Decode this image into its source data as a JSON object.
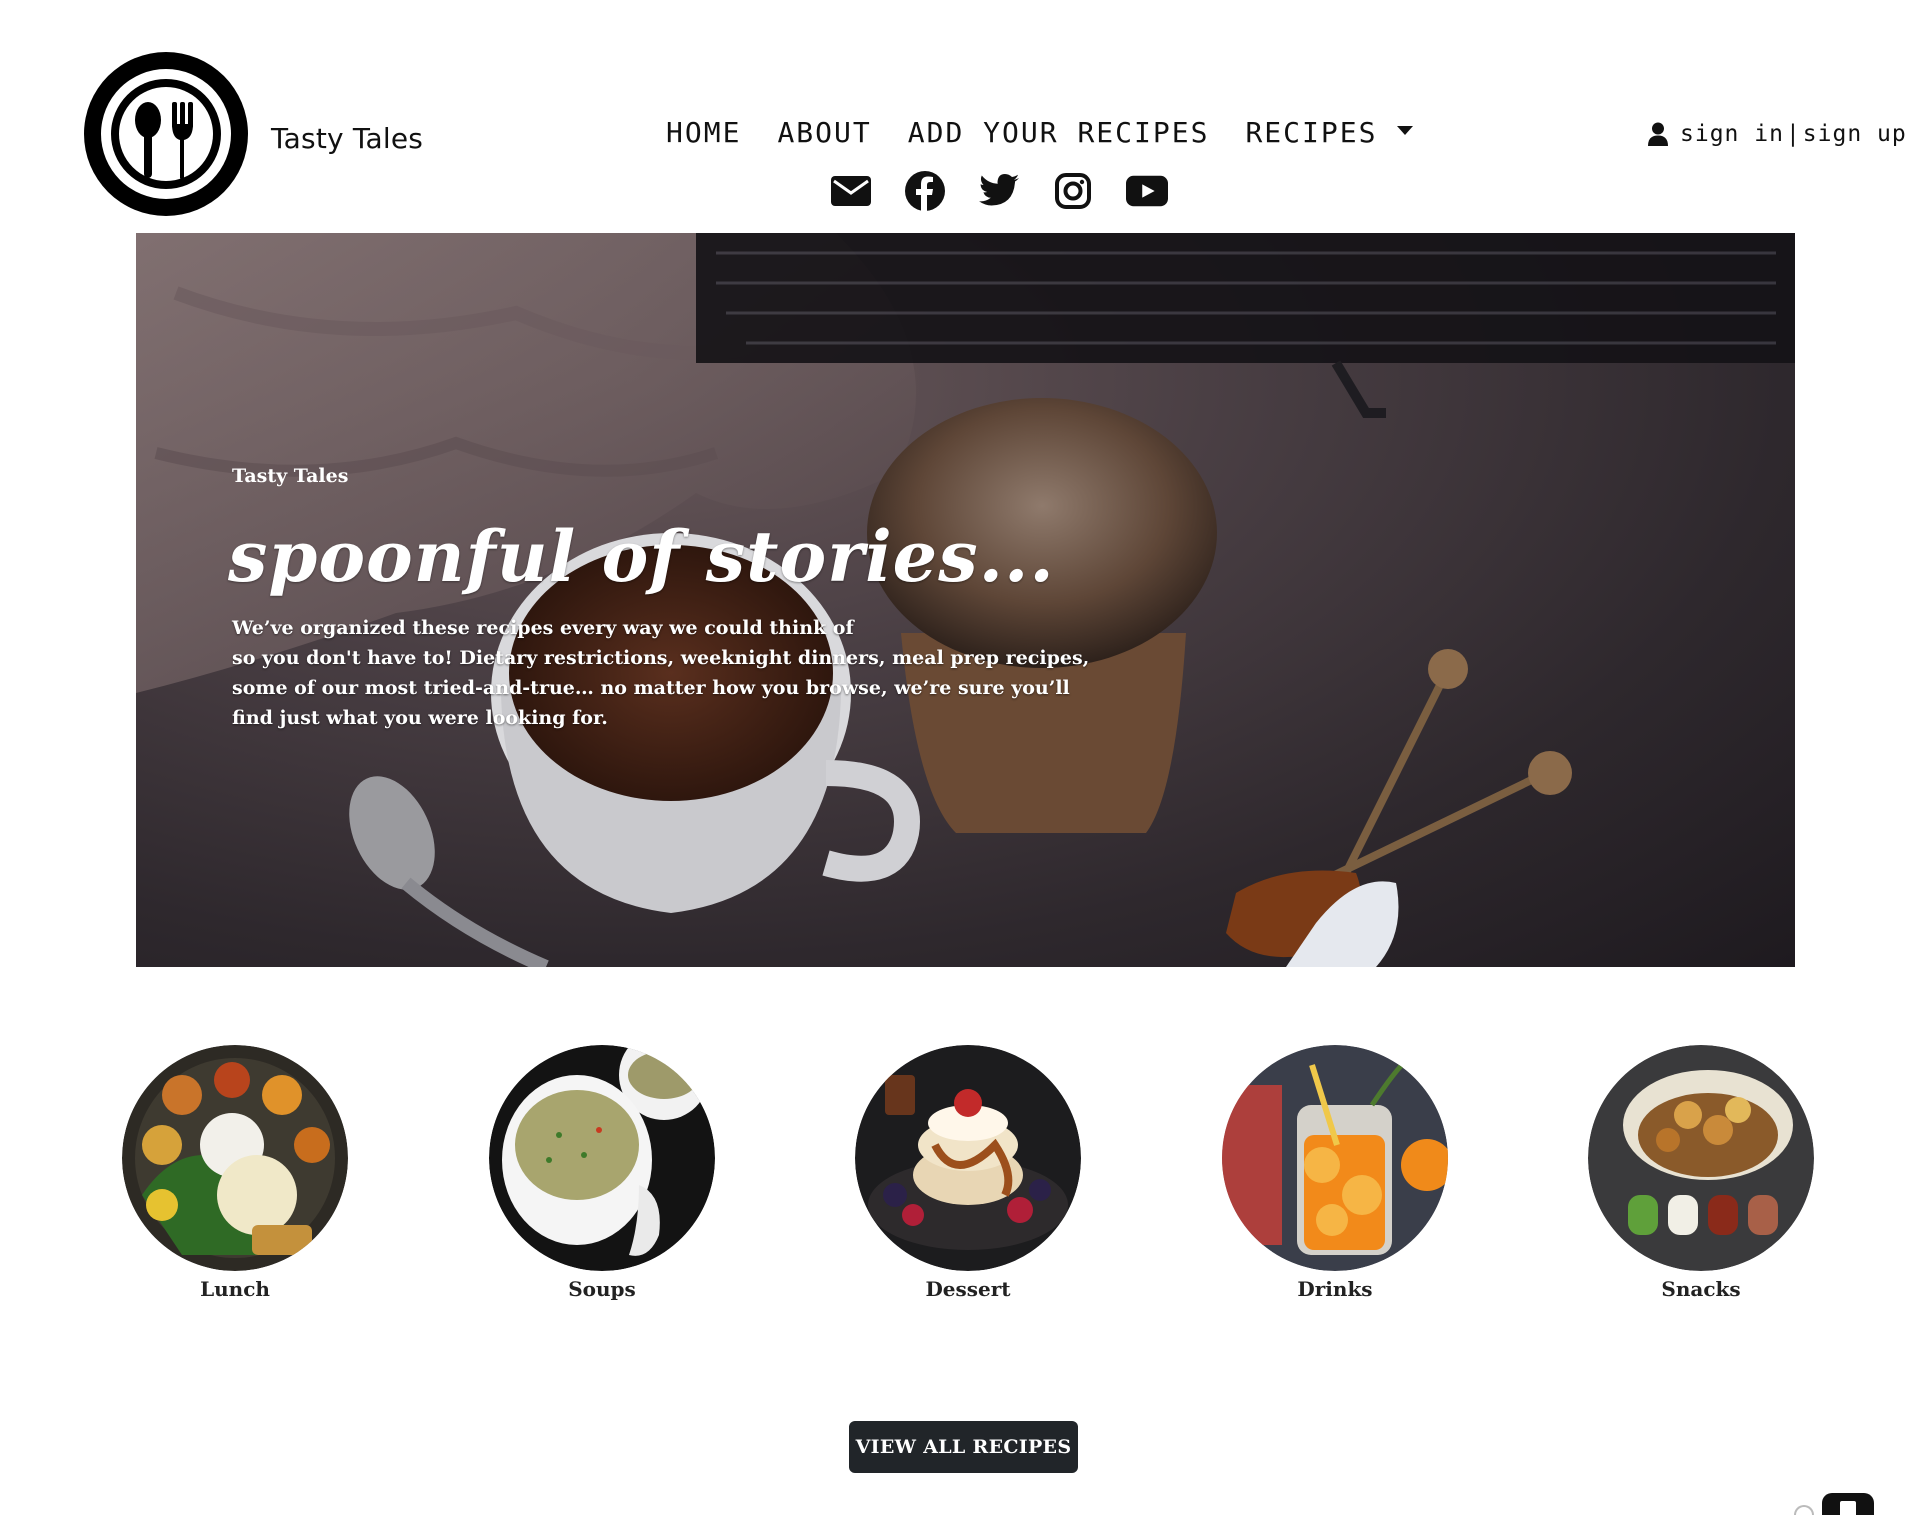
{
  "header": {
    "brand": "Tasty Tales",
    "nav": [
      {
        "label": "HOME"
      },
      {
        "label": "ABOUT"
      },
      {
        "label": "ADD YOUR RECIPES"
      },
      {
        "label": "RECIPES",
        "dropdown": true
      }
    ],
    "social_icons": [
      "envelope-icon",
      "facebook-icon",
      "twitter-icon",
      "instagram-icon",
      "youtube-icon"
    ],
    "auth": {
      "sign_in": "sign in",
      "separator": "|",
      "sign_up": "sign up",
      "icon": "user-icon"
    }
  },
  "hero": {
    "kicker": "Tasty Tales",
    "headline": "spoonful of stories...",
    "description_lines": [
      "We’ve organized these recipes every way we could think of",
      "so you don't have to! Dietary restrictions, weeknight dinners, meal prep recipes,",
      "some of our most tried-and-true… no matter how you browse, we’re sure you’ll",
      "find just what you were looking for."
    ]
  },
  "categories": [
    {
      "label": "Lunch"
    },
    {
      "label": "Soups"
    },
    {
      "label": "Dessert"
    },
    {
      "label": "Drinks"
    },
    {
      "label": "Snacks"
    }
  ],
  "cta": {
    "view_all": "VIEW ALL RECIPES"
  },
  "colors": {
    "primary_dark": "#212529",
    "text": "#111111",
    "background": "#ffffff"
  }
}
